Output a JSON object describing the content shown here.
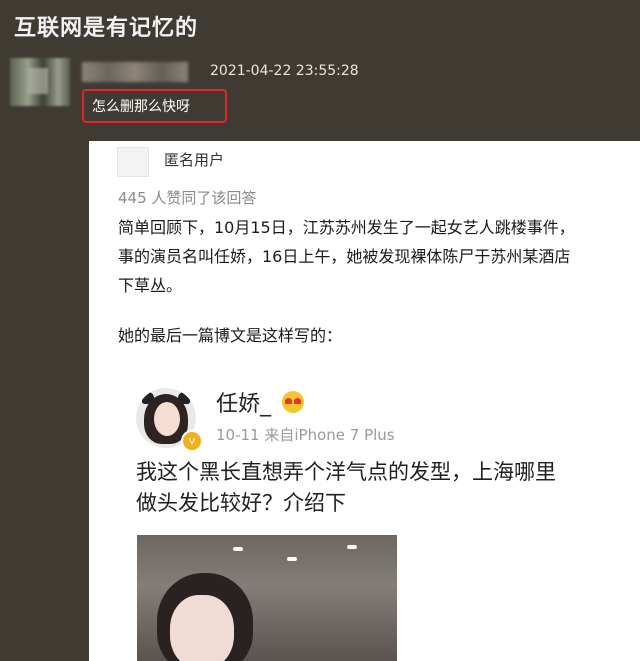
{
  "header": {
    "title": "互联网是有记忆的"
  },
  "comment": {
    "timestamp": "2021-04-22 23:55:28",
    "text": "怎么删那么快呀",
    "highlight_color": "#e0262a"
  },
  "answer": {
    "author": "匿名用户",
    "likes": "445 人赞同了该回答",
    "paragraph_lines": [
      "简单回顾下，10月15日，江苏苏州发生了一起女艺人跳楼事件，",
      "事的演员名叫任娇，16日上午，她被发现裸体陈尸于苏州某酒店",
      "下草丛。"
    ],
    "paragraph2": "她的最后一篇博文是这样写的："
  },
  "weibo": {
    "name": "任娇_",
    "meta": "10-11  来自iPhone 7 Plus",
    "text_lines": [
      "我这个黑长直想弄个洋气点的发型，上海哪里",
      "做头发比较好？介绍下"
    ],
    "verified_color": "#f2b01e"
  },
  "colors": {
    "background": "#3f3b33",
    "card": "#ffffff"
  }
}
